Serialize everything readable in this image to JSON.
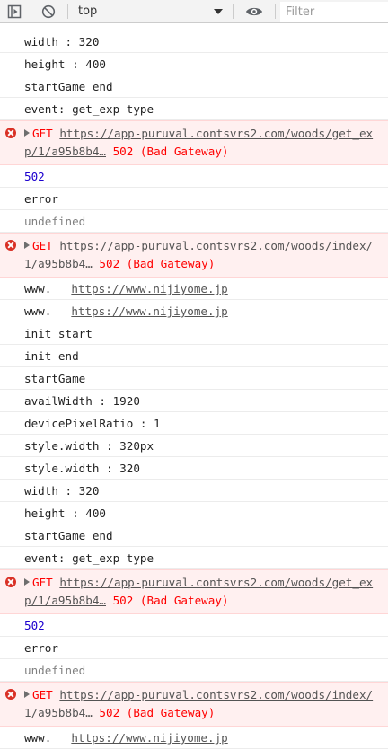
{
  "toolbar": {
    "context": "top",
    "filter_placeholder": "Filter"
  },
  "console": {
    "rows": [
      {
        "type": "log",
        "text": "width : 320"
      },
      {
        "type": "log",
        "text": "height : 400"
      },
      {
        "type": "log",
        "text": "startGame end"
      },
      {
        "type": "log",
        "text": "event: get_exp type"
      },
      {
        "type": "error",
        "method": "GET",
        "url": "https://app-puruval.contsvrs2.com/woods/get_exp/1/a95b8b4…",
        "status": "502 (Bad Gateway)"
      },
      {
        "type": "number",
        "text": "502"
      },
      {
        "type": "log",
        "text": "error"
      },
      {
        "type": "undefined",
        "text": "undefined"
      },
      {
        "type": "error",
        "method": "GET",
        "url": "https://app-puruval.contsvrs2.com/woods/index/1/a95b8b4…",
        "status": "502 (Bad Gateway)"
      },
      {
        "type": "link",
        "prefix": "www.",
        "url": "https://www.nijiyome.jp"
      },
      {
        "type": "link",
        "prefix": "www.",
        "url": "https://www.nijiyome.jp"
      },
      {
        "type": "log",
        "text": "init start"
      },
      {
        "type": "log",
        "text": "init end"
      },
      {
        "type": "log",
        "text": "startGame"
      },
      {
        "type": "log",
        "text": "availWidth : 1920"
      },
      {
        "type": "log",
        "text": "devicePixelRatio : 1"
      },
      {
        "type": "log",
        "text": "style.width : 320px"
      },
      {
        "type": "log",
        "text": "style.width : 320"
      },
      {
        "type": "log",
        "text": "width : 320"
      },
      {
        "type": "log",
        "text": "height : 400"
      },
      {
        "type": "log",
        "text": "startGame end"
      },
      {
        "type": "log",
        "text": "event: get_exp type"
      },
      {
        "type": "error",
        "method": "GET",
        "url": "https://app-puruval.contsvrs2.com/woods/get_exp/1/a95b8b4…",
        "status": "502 (Bad Gateway)"
      },
      {
        "type": "number",
        "text": "502"
      },
      {
        "type": "log",
        "text": "error"
      },
      {
        "type": "undefined",
        "text": "undefined"
      },
      {
        "type": "error",
        "method": "GET",
        "url": "https://app-puruval.contsvrs2.com/woods/index/1/a95b8b4…",
        "status": "502 (Bad Gateway)"
      },
      {
        "type": "link",
        "prefix": "www.",
        "url": "https://www.nijiyome.jp"
      }
    ]
  },
  "colors": {
    "error_text": "#ff0000",
    "error_bg": "#fff0f0",
    "number_text": "#1c00cf",
    "undefined_text": "#808080"
  }
}
